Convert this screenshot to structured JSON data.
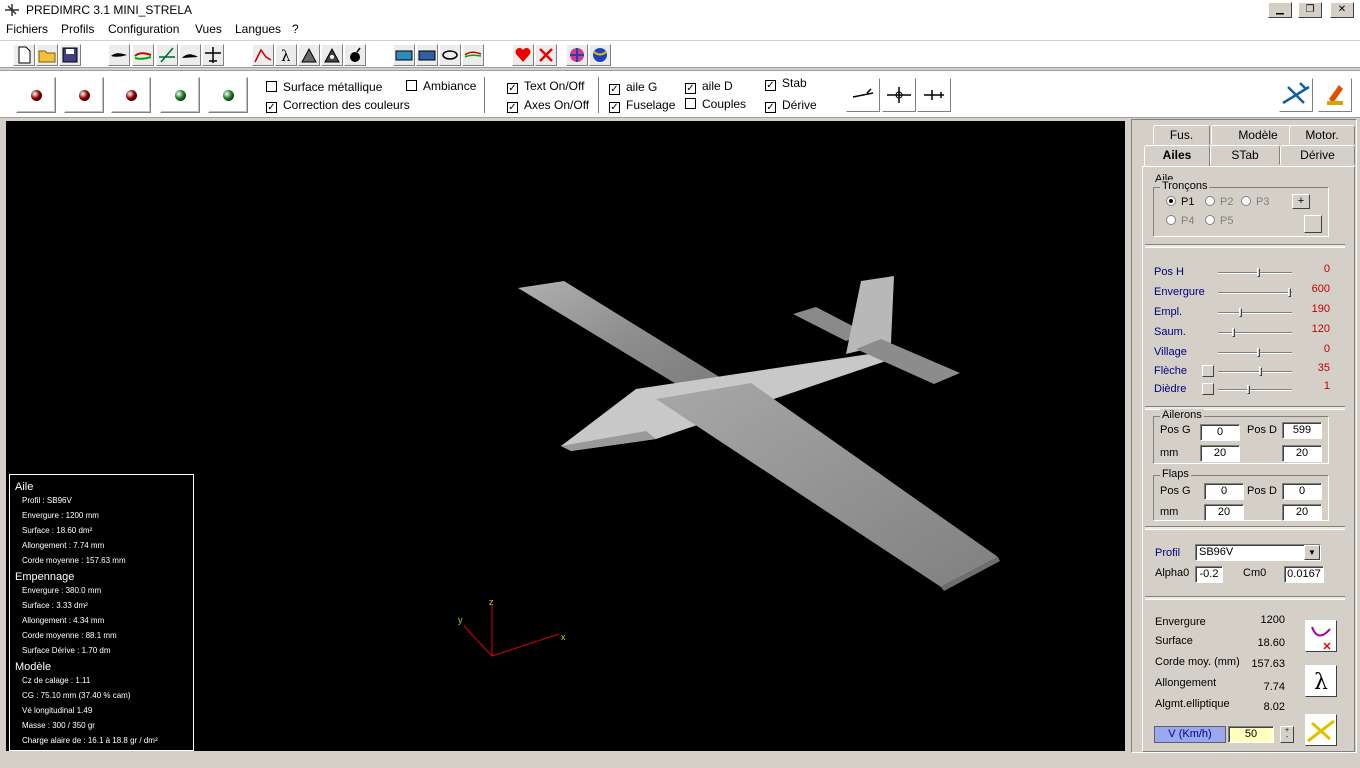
{
  "window": {
    "title": "PREDIMRC 3.1 MINI_STRELA",
    "controls": [
      "minimize-icon",
      "restore-icon",
      "close-icon"
    ]
  },
  "menu": {
    "items": [
      {
        "label": "Fichiers"
      },
      {
        "label": "Profils"
      },
      {
        "label": "Configuration"
      },
      {
        "label": "Vues"
      },
      {
        "label": "Langues"
      },
      {
        "label": "?"
      }
    ]
  },
  "toolbar1": {
    "icons": [
      "new-file-icon",
      "open-folder-icon",
      "save-icon",
      "airfoil-icon",
      "airfoil-color-icon",
      "airfoil-edit-icon",
      "wing-profile-icon",
      "plane-top-icon",
      "curve-icon",
      "lambda-icon",
      "cg-calc-icon",
      "cg-calc2-icon",
      "bomb-icon",
      "keyboard-icon",
      "keyboard2-icon",
      "loop-icon",
      "airfoil-compare-icon",
      "heart-icon",
      "close-red-icon",
      "globe-icon",
      "globe2-icon"
    ]
  },
  "toolbar2": {
    "lights": [
      {
        "color": "#8b0000"
      },
      {
        "color": "#8b0000"
      },
      {
        "color": "#8b0000"
      },
      {
        "color": "#1a7a2a"
      },
      {
        "color": "#1a7a2a"
      }
    ],
    "surface_metallique": {
      "label": "Surface métallique",
      "checked": false
    },
    "correction_couleurs": {
      "label": "Correction des couleurs",
      "checked": true
    },
    "ambiance": {
      "label": "Ambiance",
      "checked": false
    },
    "text_onoff": {
      "label": "Text On/Off",
      "checked": true
    },
    "axes_onoff": {
      "label": "Axes On/Off",
      "checked": true
    },
    "aile_g": {
      "label": "aile G",
      "checked": true
    },
    "fuselage": {
      "label": "Fuselage",
      "checked": true
    },
    "aile_d": {
      "label": "aile D",
      "checked": true
    },
    "couples": {
      "label": "Couples",
      "checked": false
    },
    "stab": {
      "label": "Stab",
      "checked": true
    },
    "derive": {
      "label": "Dérive",
      "checked": true
    },
    "view_icons": [
      "side-view-icon",
      "front-view-icon",
      "top-view-icon"
    ],
    "right_icons": [
      "plane-3d-icon",
      "paint-icon"
    ]
  },
  "viewport": {
    "axes": {
      "x": "x",
      "y": "y",
      "z": "z"
    },
    "info": {
      "aile_title": "Aile",
      "aile": [
        "Profil : SB96V",
        "Envergure : 1200 mm",
        "Surface : 18.60 dm²",
        "Allongement : 7.74 mm",
        "Corde moyenne : 157.63 mm"
      ],
      "empennage_title": "Empennage",
      "empennage": [
        "Envergure : 380.0 mm",
        "Surface : 3.33 dm²",
        "Allongement : 4.34 mm",
        "Corde moyenne : 88.1 mm",
        "Surface Dérive : 1.70 dm"
      ],
      "modele_title": "Modèle",
      "modele": [
        "Cz de calage : 1.11",
        "CG : 75.10 mm (37.40 % cam)",
        "Vé longitudinal 1.49",
        "Masse : 300 / 350 gr",
        "Charge alaire de : 16.1 à 18.8 gr / dm²"
      ]
    }
  },
  "panel": {
    "tabs_top": [
      "Fus.",
      "Modèle",
      "Motor."
    ],
    "tabs_bottom": [
      "Ailes",
      "STab",
      "Dérive"
    ],
    "aile_group": "Aile",
    "troncons_group": "Tronçons",
    "troncons": [
      {
        "label": "P1",
        "on": true,
        "enabled": true
      },
      {
        "label": "P2",
        "on": false,
        "enabled": false
      },
      {
        "label": "P3",
        "on": false,
        "enabled": false
      },
      {
        "label": "P4",
        "on": false,
        "enabled": false
      },
      {
        "label": "P5",
        "on": false,
        "enabled": false
      }
    ],
    "plus_button": "+",
    "params": [
      {
        "label": "Pos H",
        "value": "0",
        "pos": 0.55,
        "tiny": false
      },
      {
        "label": "Envergure",
        "value": "600",
        "pos": 1.0,
        "tiny": false
      },
      {
        "label": "Empl.",
        "value": "190",
        "pos": 0.3,
        "tiny": false
      },
      {
        "label": "Saum.",
        "value": "120",
        "pos": 0.2,
        "tiny": false
      },
      {
        "label": "Village",
        "value": "0",
        "pos": 0.55,
        "tiny": false
      },
      {
        "label": "Flèche",
        "value": "35",
        "pos": 0.58,
        "tiny": true
      },
      {
        "label": "Dièdre",
        "value": "1",
        "pos": 0.42,
        "tiny": true
      }
    ],
    "ailerons": {
      "title": "Ailerons",
      "pos_g": "Pos G",
      "pos_d": "Pos D",
      "mm": "mm",
      "pos_g_val": "0",
      "pos_d_val": "599",
      "mm_g": "20",
      "mm_d": "20"
    },
    "flaps": {
      "title": "Flaps",
      "pos_g": "Pos G",
      "pos_d": "Pos D",
      "mm": "mm",
      "pos_g_val": "0",
      "pos_d_val": "0",
      "mm_g": "20",
      "mm_d": "20"
    },
    "profil": {
      "label": "Profil",
      "value": "SB96V",
      "alpha0_label": "Alpha0",
      "alpha0": "-0.2",
      "cm0_label": "Cm0",
      "cm0": "0.0167"
    },
    "results": [
      {
        "label": "Envergure",
        "value": "1200"
      },
      {
        "label": "Surface",
        "value": "18.60"
      },
      {
        "label": "Corde moy. (mm)",
        "value": "157.63"
      },
      {
        "label": "Allongement",
        "value": "7.74"
      },
      {
        "label": "Algmt.elliptique",
        "value": "8.02"
      }
    ],
    "speed": {
      "label": "V (Km/h)",
      "value": "50"
    },
    "result_icons": [
      "polar-curve-icon",
      "lambda-icon",
      "plane-speed-icon"
    ]
  }
}
